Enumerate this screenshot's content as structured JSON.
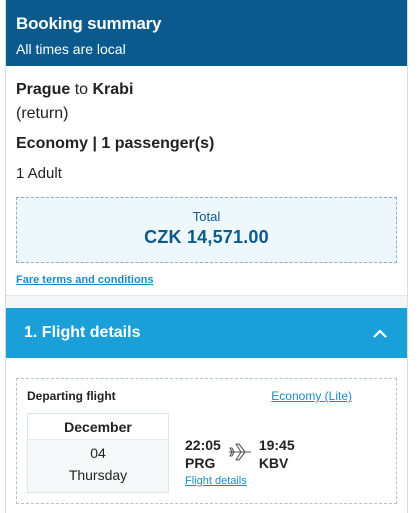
{
  "header": {
    "title": "Booking summary",
    "subtitle": "All times are local"
  },
  "route": {
    "origin": "Prague",
    "connector": "to",
    "destination": "Krabi",
    "trip_type": "(return)"
  },
  "cabin_line": "Economy | 1 passenger(s)",
  "passengers": "1 Adult",
  "total": {
    "label": "Total",
    "value": "CZK 14,571.00"
  },
  "fare_link": "Fare terms and conditions",
  "section": {
    "title": "1. Flight details",
    "expanded": true,
    "icon": "chevron-up-icon"
  },
  "flight": {
    "direction_label": "Departing flight",
    "fare_link": "Economy (Lite)",
    "date": {
      "month": "December",
      "day": "04",
      "weekday": "Thursday"
    },
    "departure": {
      "time": "22:05",
      "code": "PRG"
    },
    "arrival": {
      "time": "19:45",
      "code": "KBV"
    },
    "details_link": "Flight details",
    "icon": "airplane-icon"
  },
  "colors": {
    "header_bg": "#0a5a8e",
    "section_bg": "#1a9fd9",
    "link": "#1a8bc7",
    "total_bg": "#eef7fb"
  }
}
